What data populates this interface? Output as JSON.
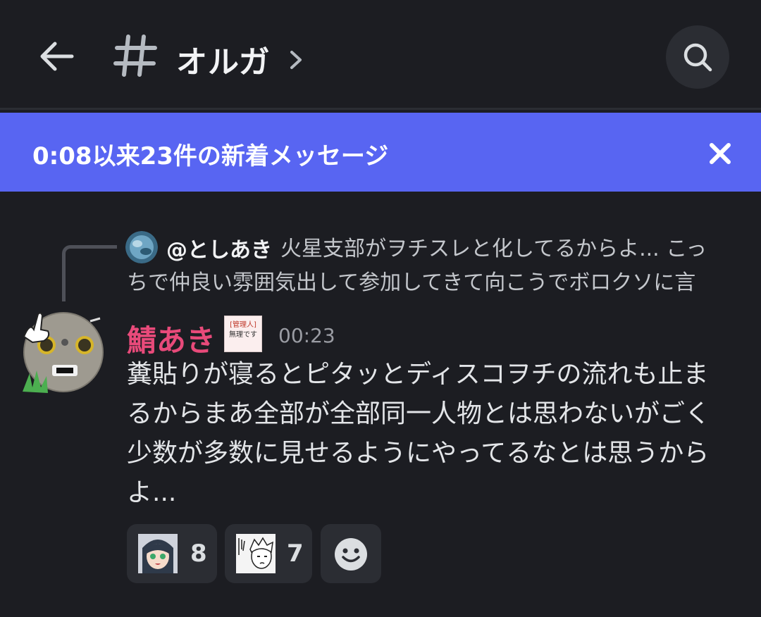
{
  "header": {
    "channel_name": "オルガ"
  },
  "banner": {
    "text": "0:08以来23件の新着メッセージ"
  },
  "reply": {
    "author": "@としあき",
    "text": "火星支部がヲチスレと化してるからよ... こっちで仲良い雰囲気出して参加してきて向こうでボロクソに言"
  },
  "message": {
    "author": "鯖あき",
    "author_color": "#e84a7a",
    "role_badge": [
      "[管理人]",
      "無理です"
    ],
    "timestamp": "00:23",
    "text": "糞貼りが寝るとピタッとディスコヲチの流れも止まるからまあ全部が全部同一人物とは思わないがごく少数が多数に見せるようにやってるなとは思うからよ..."
  },
  "reactions": [
    {
      "emoji": "anime-girl-emoji",
      "count": "8"
    },
    {
      "emoji": "manga-boy-emoji",
      "count": "7"
    }
  ],
  "colors": {
    "background": "#1c1d22",
    "banner": "#5865f2",
    "pill": "#2b2d33"
  }
}
